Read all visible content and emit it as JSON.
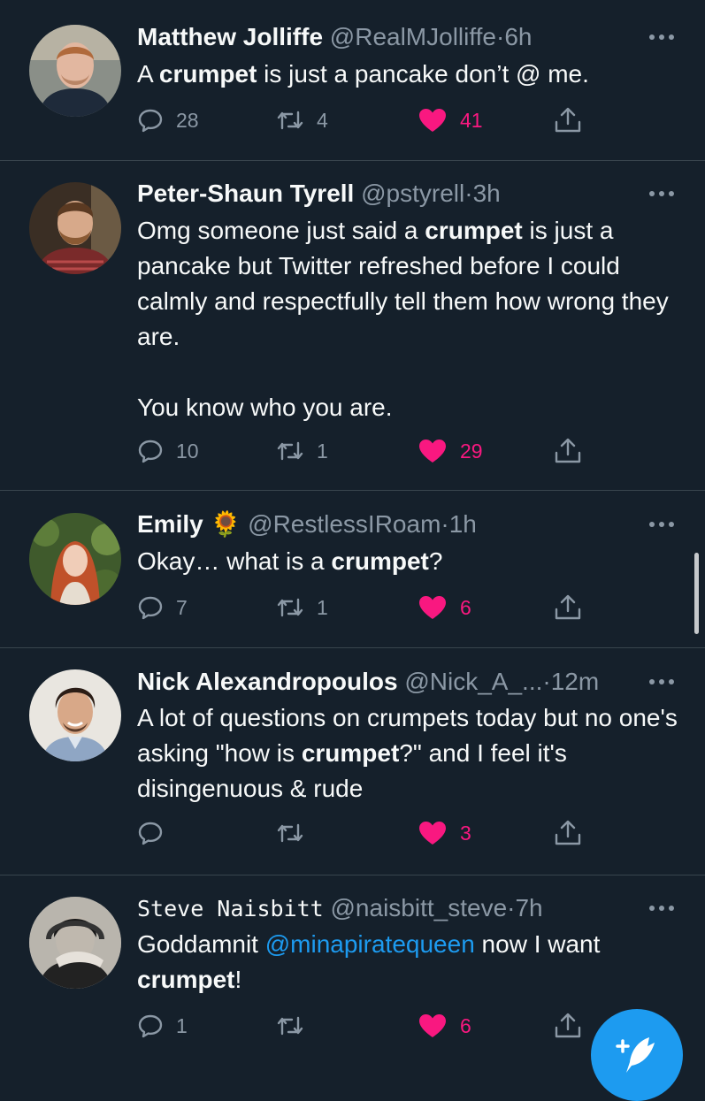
{
  "tweets": [
    {
      "name": "Matthew Jolliffe",
      "handle": "@RealMJolliffe",
      "dot": "·",
      "time": "6h",
      "segments": [
        {
          "t": "A ",
          "b": false
        },
        {
          "t": "crumpet",
          "b": true
        },
        {
          "t": " is just a pancake don’t @ me.",
          "b": false
        }
      ],
      "replies": "28",
      "retweets": "4",
      "likes": "41"
    },
    {
      "name": "Peter-Shaun Tyrell",
      "handle": "@pstyrell",
      "dot": "·",
      "time": "3h",
      "segments": [
        {
          "t": "Omg someone just said a ",
          "b": false
        },
        {
          "t": "crumpet",
          "b": true
        },
        {
          "t": " is just a pancake but Twitter refreshed before I could calmly and respectfully tell them how wrong they are.\n\nYou know who you are.",
          "b": false
        }
      ],
      "replies": "10",
      "retweets": "1",
      "likes": "29"
    },
    {
      "name": "Emily",
      "emoji": "🌻",
      "handle": "@RestlessIRoam",
      "dot": "·",
      "time": "1h",
      "segments": [
        {
          "t": "Okay… what is a ",
          "b": false
        },
        {
          "t": "crumpet",
          "b": true
        },
        {
          "t": "?",
          "b": false
        }
      ],
      "replies": "7",
      "retweets": "1",
      "likes": "6"
    },
    {
      "name": "Nick Alexandropoulos",
      "handle": "@Nick_A_...",
      "dot": "·",
      "time": "12m",
      "segments": [
        {
          "t": "A lot of questions on crumpets today but no one's asking \"how is ",
          "b": false
        },
        {
          "t": "crumpet",
          "b": true
        },
        {
          "t": "?\" and I feel it's disingenuous & rude",
          "b": false
        }
      ],
      "replies": "",
      "retweets": "",
      "likes": "3"
    },
    {
      "name": "Steve Naisbitt",
      "handle": "@naisbitt_steve",
      "dot": "·",
      "time": "7h",
      "segments": [
        {
          "t": "Goddamnit ",
          "b": false
        },
        {
          "t": "@minapiratequeen",
          "b": false,
          "m": true
        },
        {
          "t": " now I want ",
          "b": false
        },
        {
          "t": "crumpet",
          "b": true
        },
        {
          "t": "!",
          "b": false
        }
      ],
      "replies": "1",
      "retweets": "",
      "likes": "6"
    }
  ],
  "icons": {
    "reply": "reply-icon",
    "retweet": "retweet-icon",
    "like": "heart-icon",
    "share": "share-icon",
    "more": "more-icon",
    "compose": "compose-tweet-icon"
  },
  "colors": {
    "background": "#15202b",
    "divider": "#38444d",
    "secondary_text": "#8b98a5",
    "like": "#f91880",
    "accent": "#1d9bf0"
  }
}
